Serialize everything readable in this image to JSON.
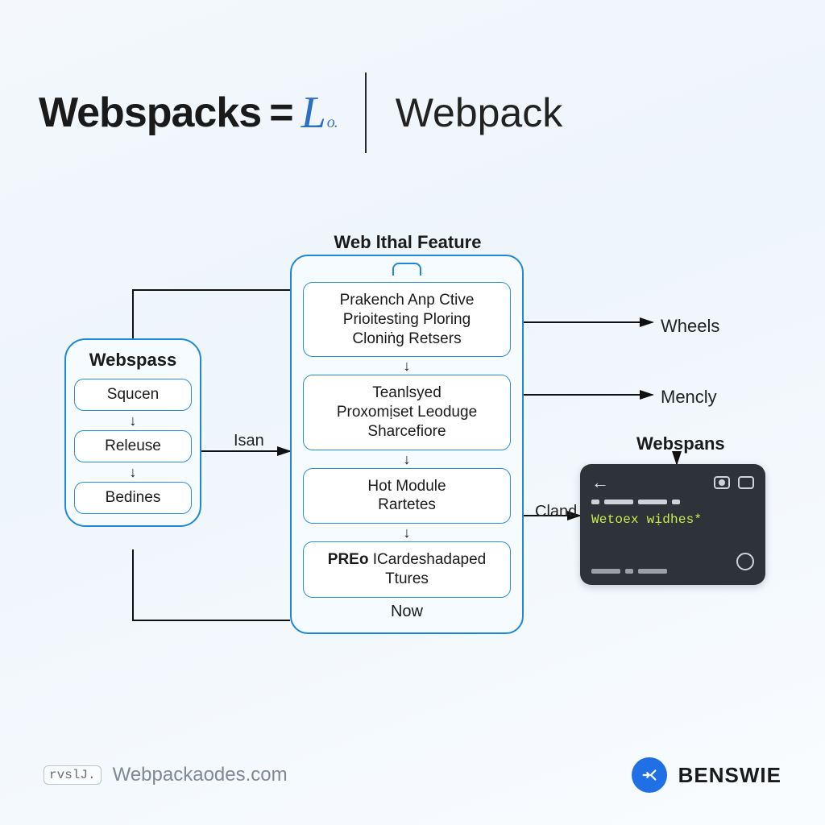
{
  "header": {
    "left_title": "Webspacks",
    "equals": "=",
    "logo_text": "L",
    "logo_suffix": "o.",
    "right_title": "Webpack"
  },
  "diagram": {
    "left_group": {
      "title": "Webspass",
      "items": [
        "Squcen",
        "Releuse",
        "Bedines"
      ]
    },
    "center_group": {
      "title": "Web lthal Feature",
      "blocks": [
        {
          "l1": "Prakench Anp Ctive",
          "l2": "Prioitesting Ploring",
          "l3": "Cloniṅg Retsers"
        },
        {
          "l1": "Teanlsyed",
          "l2": "Proxomịset Leoduge",
          "l3": "Sharcefiore"
        },
        {
          "l1": "Hot Module",
          "l2": "Rartetes",
          "l3": ""
        },
        {
          "l1_bold": "PREo",
          "l1_rest": " ICardeshadaped",
          "l2": "Ttures",
          "l3": ""
        }
      ],
      "bottom_label": "Now"
    },
    "edge_labels": {
      "isan": "Isan",
      "cland": "Cland"
    },
    "right_labels": {
      "wheels": "Wheels",
      "mencly": "Mencly",
      "subtitle": "Webspans"
    },
    "terminal": {
      "code_line": "Wetoex wịdhes*"
    }
  },
  "footer": {
    "badge": "rvslJ.",
    "site": "Webpackaodes.com",
    "brand": "BENSWIE"
  },
  "colors": {
    "accent": "#1e88d8",
    "terminal_bg": "#2e333a",
    "code_green": "#c7ef4a"
  }
}
